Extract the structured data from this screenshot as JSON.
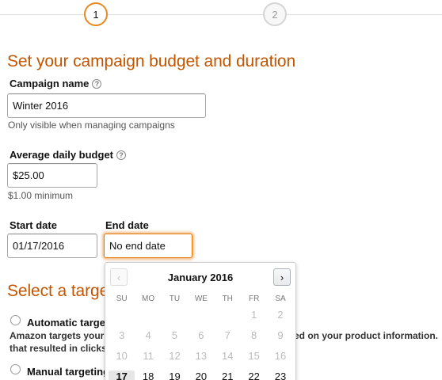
{
  "stepper": {
    "steps": [
      {
        "label": "1",
        "state": "active"
      },
      {
        "label": "2",
        "state": "inactive"
      }
    ],
    "accent_color": "#e7891e"
  },
  "budget_section": {
    "heading": "Set your campaign budget and duration",
    "campaign_name": {
      "label": "Campaign name",
      "help_icon": "question-circle-icon",
      "value": "Winter 2016",
      "hint": "Only visible when managing campaigns"
    },
    "daily_budget": {
      "label": "Average daily budget",
      "help_icon": "question-circle-icon",
      "value": "$25.00",
      "hint": "$1.00 minimum"
    },
    "start_date": {
      "label": "Start date",
      "value": "01/17/2016"
    },
    "end_date": {
      "label": "End date",
      "value": "No end date"
    }
  },
  "targeting_section": {
    "heading": "Select a targe",
    "automatic": {
      "label": "Automatic targe",
      "desc_line1_left": "Amazon targets your",
      "desc_line1_right": "ed on your product information.",
      "desc_line2": "that resulted in clicks"
    },
    "manual": {
      "label": "Manual targeting"
    }
  },
  "calendar": {
    "title": "January 2016",
    "prev_icon": "chevron-left-icon",
    "next_icon": "chevron-right-icon",
    "weekdays": [
      "SU",
      "MO",
      "TU",
      "WE",
      "TH",
      "FR",
      "SA"
    ],
    "weeks": [
      [
        {
          "day": "",
          "state": "empty"
        },
        {
          "day": "",
          "state": "empty"
        },
        {
          "day": "",
          "state": "empty"
        },
        {
          "day": "",
          "state": "empty"
        },
        {
          "day": "",
          "state": "empty"
        },
        {
          "day": "1",
          "state": "disabled"
        },
        {
          "day": "2",
          "state": "disabled"
        }
      ],
      [
        {
          "day": "3",
          "state": "disabled"
        },
        {
          "day": "4",
          "state": "disabled"
        },
        {
          "day": "5",
          "state": "disabled"
        },
        {
          "day": "6",
          "state": "disabled"
        },
        {
          "day": "7",
          "state": "disabled"
        },
        {
          "day": "8",
          "state": "disabled"
        },
        {
          "day": "9",
          "state": "disabled"
        }
      ],
      [
        {
          "day": "10",
          "state": "disabled"
        },
        {
          "day": "11",
          "state": "disabled"
        },
        {
          "day": "12",
          "state": "disabled"
        },
        {
          "day": "13",
          "state": "disabled"
        },
        {
          "day": "14",
          "state": "disabled"
        },
        {
          "day": "15",
          "state": "disabled"
        },
        {
          "day": "16",
          "state": "disabled"
        }
      ],
      [
        {
          "day": "17",
          "state": "today"
        },
        {
          "day": "18",
          "state": "active"
        },
        {
          "day": "19",
          "state": "active"
        },
        {
          "day": "20",
          "state": "active"
        },
        {
          "day": "21",
          "state": "active"
        },
        {
          "day": "22",
          "state": "active"
        },
        {
          "day": "23",
          "state": "active"
        }
      ]
    ]
  }
}
